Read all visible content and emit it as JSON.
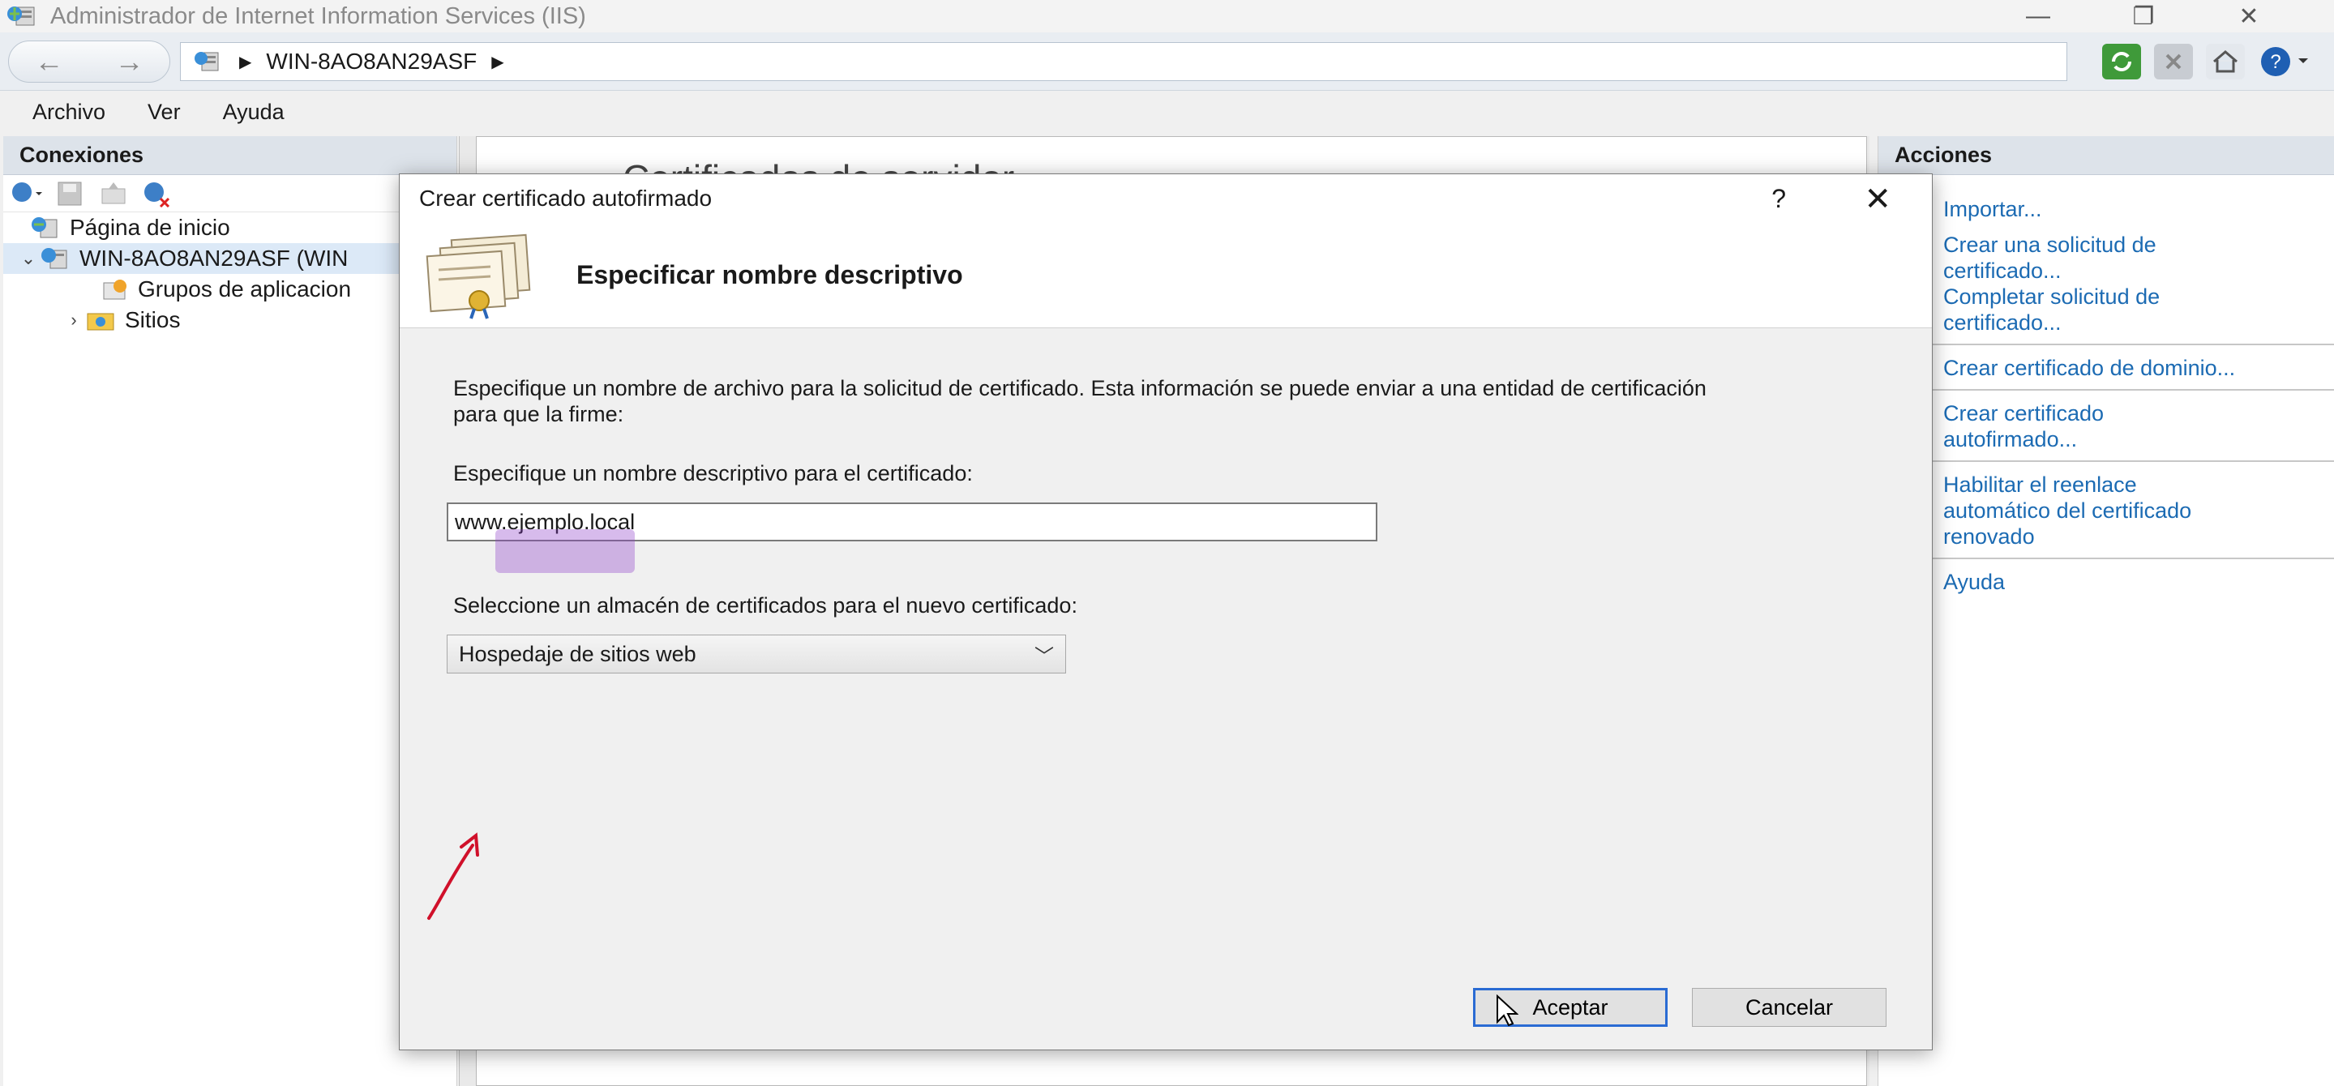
{
  "window": {
    "title": "Administrador de Internet Information Services (IIS)",
    "controls": [
      "—",
      "❐",
      "✕"
    ]
  },
  "address": {
    "back": "←",
    "forward": "→",
    "path": "WIN-8AO8AN29ASF"
  },
  "menu": [
    "Archivo",
    "Ver",
    "Ayuda"
  ],
  "connections": {
    "header": "Conexiones",
    "tree": [
      {
        "label": "Página de inicio"
      },
      {
        "label": "WIN-8AO8AN29ASF (WIN",
        "expander": "⌄"
      },
      {
        "label": "Grupos de aplicacion"
      },
      {
        "label": "Sitios",
        "expander": "›"
      }
    ]
  },
  "background_title": "Certificados de servidor",
  "actions": {
    "header": "Acciones",
    "groups": [
      [
        "Importar...",
        "Crear una solicitud de",
        "certificado...",
        "Completar solicitud de",
        "certificado..."
      ],
      [
        "Crear certificado de dominio..."
      ],
      [
        "Crear certificado",
        "autofirmado..."
      ],
      [
        "Habilitar el reenlace",
        "automático del certificado",
        "renovado"
      ],
      [
        "Ayuda"
      ]
    ]
  },
  "dialog": {
    "title": "Crear certificado autofirmado",
    "help": "?",
    "close": "✕",
    "heading": "Especificar nombre descriptivo",
    "description": "Especifique un nombre de archivo para la solicitud de certificado. Esta información se puede enviar a una entidad de certificación para que la firme:",
    "name_label": "Especifique un nombre descriptivo para el certificado:",
    "name_value": "www.ejemplo.local",
    "store_label": "Seleccione un almacén de certificados para el nuevo certificado:",
    "store_value": "Hospedaje de sitios web",
    "ok": "Aceptar",
    "cancel": "Cancelar"
  },
  "colors": {
    "link": "#1c6bb3",
    "annotation": "#d0102a",
    "highlight": "#8c3cc8"
  }
}
